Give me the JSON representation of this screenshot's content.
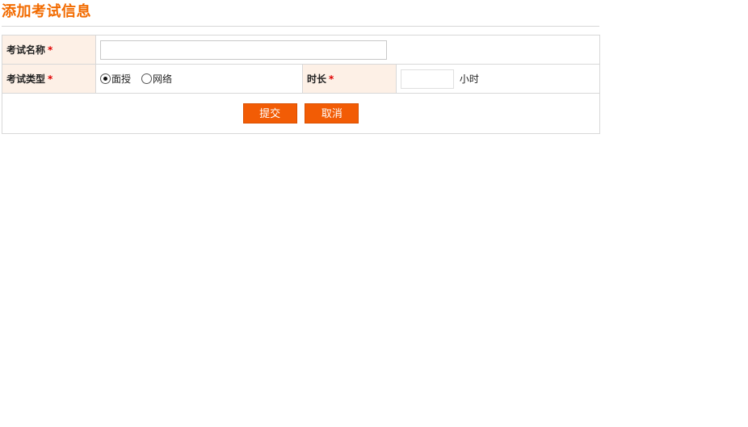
{
  "page": {
    "title": "添加考试信息"
  },
  "form": {
    "exam_name": {
      "label": "考试名称",
      "required_mark": "*",
      "value": ""
    },
    "exam_type": {
      "label": "考试类型",
      "required_mark": "*",
      "options": [
        {
          "label": "面授",
          "checked": true
        },
        {
          "label": "网络",
          "checked": false
        }
      ]
    },
    "duration": {
      "label": "时长",
      "required_mark": "*",
      "value": "",
      "unit": "小时"
    }
  },
  "actions": {
    "submit_label": "提交",
    "cancel_label": "取消"
  },
  "colors": {
    "accent": "#f26b00",
    "button_bg": "#f25c05",
    "label_bg": "#fdf0e6",
    "required": "#e00000"
  }
}
